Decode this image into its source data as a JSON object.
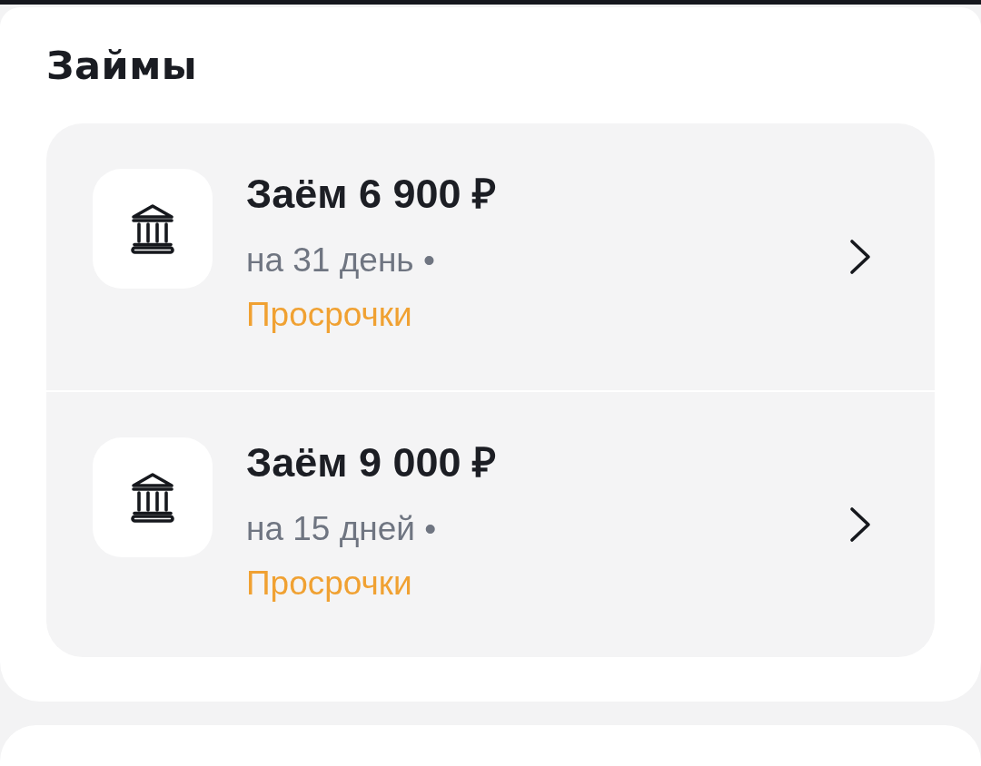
{
  "title": "Займы",
  "loans": [
    {
      "title": "Заём 6 900 ₽",
      "term": "на 31 день •",
      "status": "Просрочки"
    },
    {
      "title": "Заём 9 000 ₽",
      "term": "на 15 дней •",
      "status": "Просрочки"
    }
  ]
}
